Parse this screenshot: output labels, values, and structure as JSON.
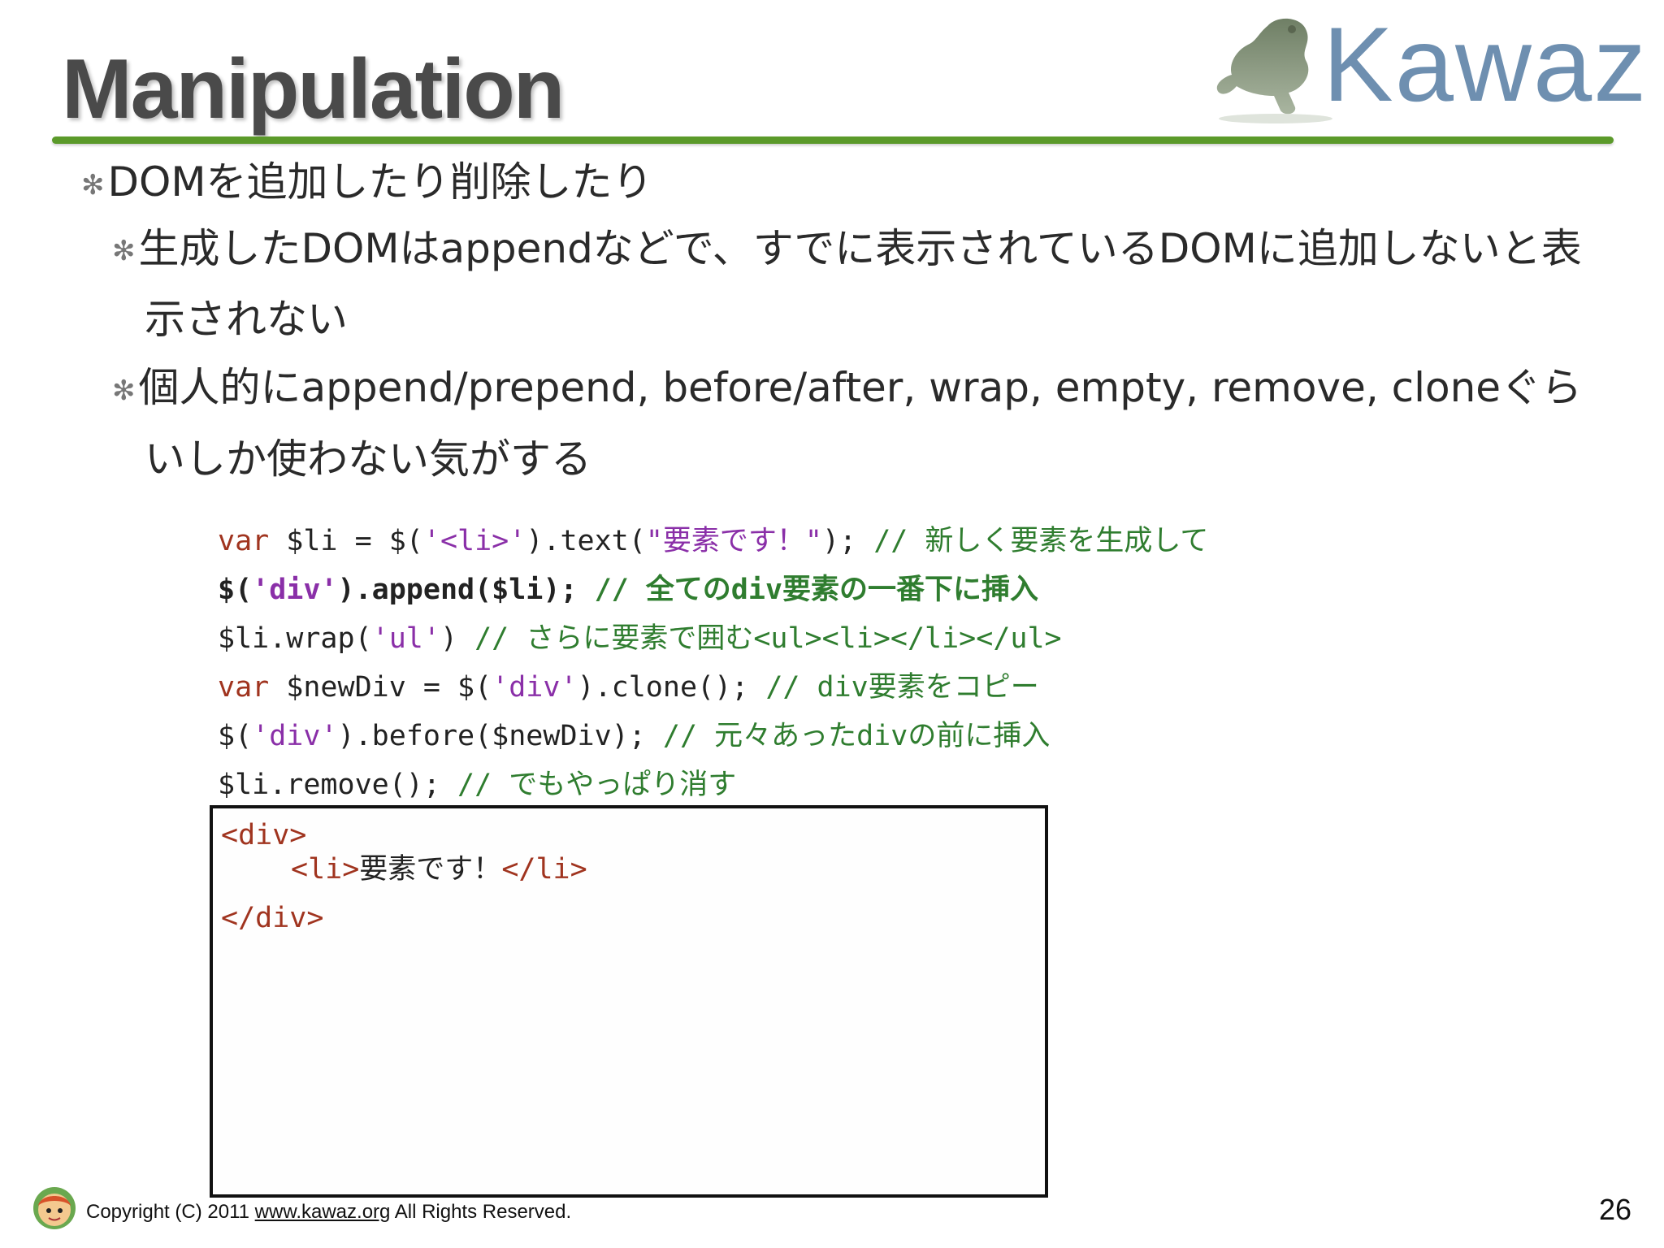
{
  "slide": {
    "title": "Manipulation",
    "logo_text": "Kawaz",
    "page_number": "26"
  },
  "bullets": {
    "b1": "DOMを追加したり削除したり",
    "b2a": "生成したDOMはappendなどで、すでに表示されているDOMに追加しないと表示されない",
    "b2b": "個人的にappend/prepend, before/after, wrap, empty, remove, cloneぐらいしか使わない気がする"
  },
  "code": {
    "l1": {
      "a": "var",
      "b": " $li = $(",
      "c": "'<li>'",
      "d": ").text(",
      "e": "\"要素です！\"",
      "f": "); ",
      "g": "// 新しく要素を生成して"
    },
    "l2": {
      "a": "$(",
      "b": "'div'",
      "c": ").append($li); ",
      "d": "// 全てのdiv要素の一番下に挿入"
    },
    "l3": {
      "a": "$li.wrap(",
      "b": "'ul'",
      "c": ") ",
      "d": "// さらに要素で囲む<ul><li></li></ul>"
    },
    "l4": {
      "a": "var",
      "b": " $newDiv = $(",
      "c": "'div'",
      "d": ").clone(); ",
      "e": "// div要素をコピー"
    },
    "l5": {
      "a": "$(",
      "b": "'div'",
      "c": ").before($newDiv); ",
      "d": "// 元々あったdivの前に挿入"
    },
    "l6": {
      "a": "$li.remove(); ",
      "b": "// でもやっぱり消す"
    }
  },
  "output": {
    "open_div": "<div>",
    "li_open": "<li>",
    "li_text": "要素です！",
    "li_close": "</li>",
    "close_div": "</div>"
  },
  "footer": {
    "copyright_prefix": "Copyright (C) 2011 ",
    "link": "www.kawaz.org",
    "copyright_suffix": " All Rights Reserved."
  },
  "colors": {
    "accent_rule": "#5b9a2a",
    "keyword": "#a0341f",
    "string": "#8a2fa8",
    "comment": "#2f7d2f",
    "logo": "#6e8fb0"
  },
  "icons": {
    "logo_frog": "frog-silhouette-icon",
    "footer_mascot": "mascot-avatar-icon",
    "bullet": "asterisk-bullet-icon"
  }
}
